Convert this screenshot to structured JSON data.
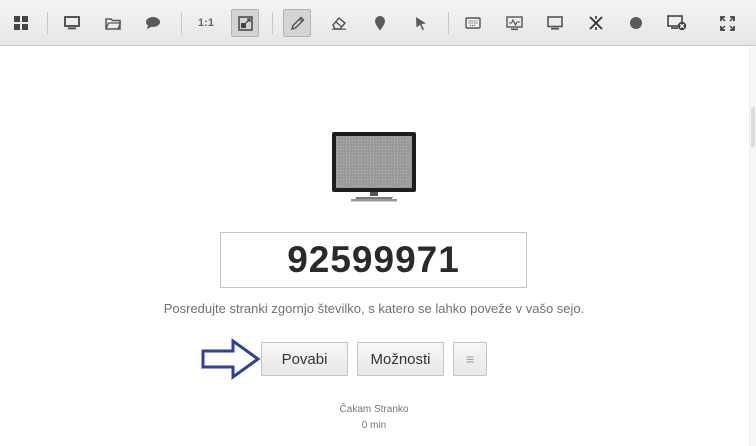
{
  "toolbar": {
    "icons": [
      "grid-icon",
      "monitor-icon",
      "folder-icon",
      "chat-icon",
      "actual-size-icon",
      "scale-to-fit-icon",
      "pencil-icon",
      "eraser-icon",
      "marker-icon",
      "pointer-icon",
      "keyboard-icon",
      "screen-signal-icon",
      "display-icon",
      "tools-icon",
      "record-icon",
      "disconnect-icon",
      "fullscreen-icon"
    ],
    "actual_size_label": "1:1"
  },
  "session": {
    "id": "92599971",
    "instructions": "Posredujte stranki zgornjo številko, s katero se lahko poveže v vašo sejo."
  },
  "actions": {
    "invite_label": "Povabi",
    "options_label": "Možnosti",
    "menu_label": "≡"
  },
  "status": {
    "text": "Čakam Stranko",
    "elapsed": "0 min"
  },
  "colors": {
    "arrow": "#2f3f9e",
    "toolbar_bg": "#ececec",
    "icon": "#5a5a5a"
  }
}
